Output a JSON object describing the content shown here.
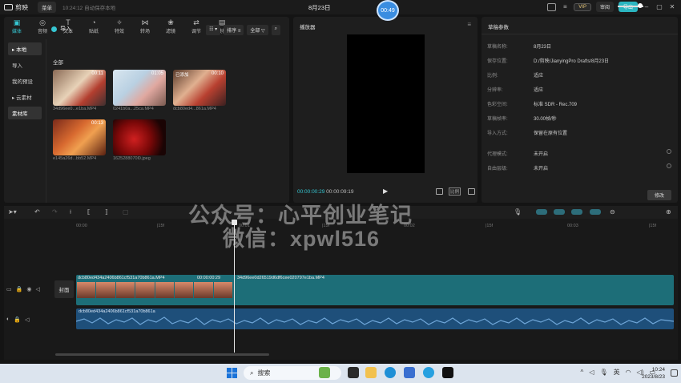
{
  "app": {
    "name": "剪映",
    "menu_label": "菜单",
    "autosave": "10:24:12 自动保存本地",
    "project_title": "8月23日",
    "recording_badge": "00:49",
    "vip_label": "VIP",
    "share_label": "审阅",
    "export_label": "导出"
  },
  "media_tabs": [
    {
      "icon": "media-icon",
      "label": "媒体"
    },
    {
      "icon": "audio-icon",
      "label": "音频"
    },
    {
      "icon": "text-icon",
      "label": "文本"
    },
    {
      "icon": "sticker-icon",
      "label": "贴纸"
    },
    {
      "icon": "effects-icon",
      "label": "特效"
    },
    {
      "icon": "transition-icon",
      "label": "转场"
    },
    {
      "icon": "filter-icon",
      "label": "滤镜"
    },
    {
      "icon": "adjust-icon",
      "label": "调节"
    },
    {
      "icon": "template-icon",
      "label": "模板"
    }
  ],
  "media_sidebar": [
    "本地",
    "导入",
    "我的预设",
    "云素材",
    "素材库"
  ],
  "media_toolbar": {
    "import_label": "导入",
    "sort_label": "排序",
    "filter_label": "全部",
    "section_label": "全部"
  },
  "clips": [
    {
      "duration": "00:11",
      "tag": "",
      "name": "34d96ee0...e1ba.MP4"
    },
    {
      "duration": "01:05",
      "tag": "",
      "name": "0241b0a...25ca.MP4"
    },
    {
      "duration": "00:10",
      "tag": "已添加",
      "name": "dcb80ed4...861a.MP4"
    },
    {
      "duration": "00:13",
      "tag": "",
      "name": "e145a26d...bb52.MP4"
    },
    {
      "duration": "",
      "tag": "",
      "name": "1625288070l0.jpeg"
    }
  ],
  "player": {
    "title": "播放器",
    "current_time": "00:00:00:29",
    "total_time": "00:00:09:19",
    "ratio_label": "比例"
  },
  "draft": {
    "title": "草稿参数",
    "rows": [
      {
        "k": "草稿名称:",
        "v": "8月23日"
      },
      {
        "k": "保存位置:",
        "v": "D:/剪映/JianyingPro Drafts/8月23日"
      },
      {
        "k": "比例:",
        "v": "适应"
      },
      {
        "k": "分辨率:",
        "v": "适应"
      },
      {
        "k": "色彩空间:",
        "v": "标准 SDR - Rec.709"
      },
      {
        "k": "草稿帧率:",
        "v": "30.00帧/秒"
      },
      {
        "k": "导入方式:",
        "v": "保留在原有位置"
      },
      {
        "k": "代理模式:",
        "v": "未开启"
      },
      {
        "k": "自由层级:",
        "v": "未开启"
      }
    ],
    "edit_label": "修改"
  },
  "timeline": {
    "ruler": [
      "00:00",
      "|15f",
      "00:01",
      "|15f",
      "00:02",
      "|15f",
      "00:03",
      "|15f"
    ],
    "cover_label": "封面",
    "video_clip_label": "dcb80ed434a2406b861cf531a70b861a.MP4",
    "video_clip_time": "00:00:00:29",
    "video_clip2_label": "34d96ee0d26519d6df6cee020797e1ba.MP4",
    "audio_clip_label": "dcb80ed434a2406b861cf531a70b861a"
  },
  "watermark": {
    "line1": "公众号：心平创业笔记",
    "line2": "微信：xpwl516"
  },
  "taskbar": {
    "search_placeholder": "搜索",
    "ime": "英",
    "time": "10:24",
    "date": "2023/8/23"
  },
  "colors": {
    "accent": "#36c6d2",
    "video_track": "#1d6e78",
    "audio_track": "#1e4f7a"
  }
}
